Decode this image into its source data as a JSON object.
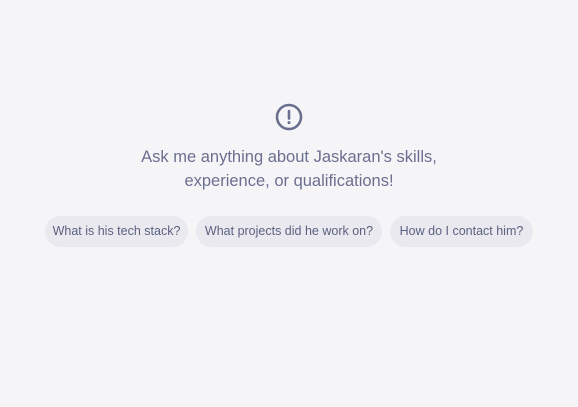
{
  "empty_state": {
    "icon": "alert-circle-icon",
    "accent_color": "#6b6f8f",
    "prompt_line_1": "Ask me anything about Jaskaran's skills,",
    "prompt_line_2": "experience, or qualifications!"
  },
  "suggestions": [
    {
      "label": "What is his tech stack?"
    },
    {
      "label": "What projects did he work on?"
    },
    {
      "label": "How do I contact him?"
    }
  ]
}
